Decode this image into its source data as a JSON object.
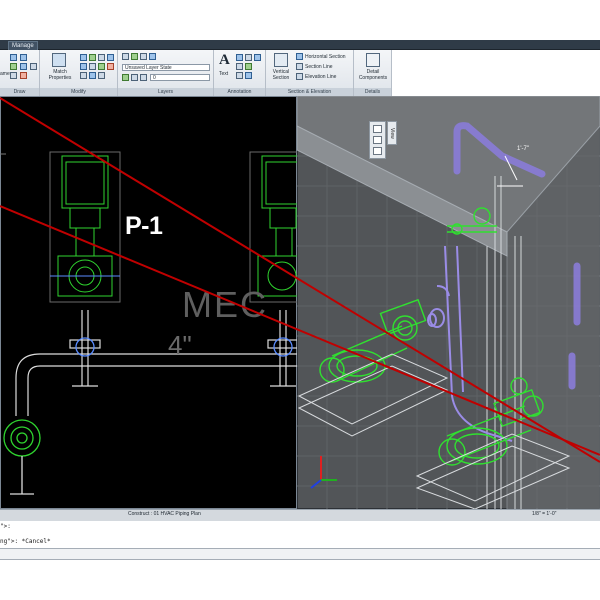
{
  "tabs": {
    "manage": "Manage"
  },
  "ribbon": {
    "panels": {
      "draw": "Draw",
      "modify": "Modify",
      "layers": "Layers",
      "annotation": "Annotation",
      "section_elevation": "Section & Elevation",
      "details": "Details"
    },
    "match_properties": "Match Properties",
    "layer_state": "Unsaved Layer State",
    "layer_number": "0",
    "text": "Text",
    "vertical_section": "Vertical Section",
    "horizontal_section": "Horizontal Section",
    "section_line": "Section Line",
    "elevation_line": "Elevation Line",
    "detail_components": "Detail Components",
    "left_partial": "ame"
  },
  "viewport_left": {
    "tag": "P-1",
    "annotation_text": "MEC",
    "pipe_size": "4\""
  },
  "viewport_right": {
    "view_label": "View",
    "dimension_text": "1'-7\""
  },
  "status": {
    "layout": "Construct : 01 HVAC Piping Plan",
    "scale": "1/8\" = 1'-0\""
  },
  "command": {
    "line1": "\">:",
    "line2": "ng\">: *Cancel*"
  },
  "colors": {
    "model_bg": "#000000",
    "view3d_bg": "#525558",
    "equipment_green": "#30e030",
    "pipe_purple": "#8a7cd8",
    "markup_red": "#c00000"
  }
}
